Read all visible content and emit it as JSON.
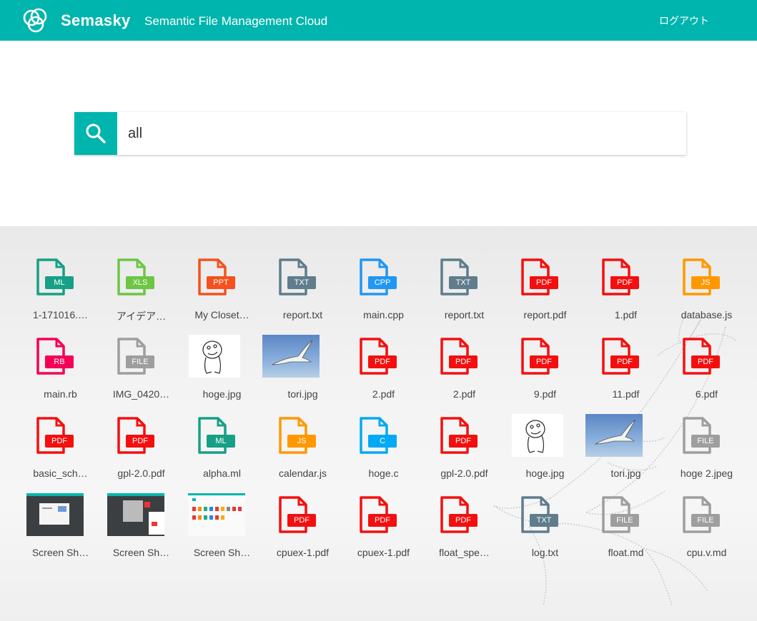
{
  "header": {
    "brand": "Semasky",
    "tagline": "Semantic File Management Cloud",
    "logout": "ログアウト",
    "brand_color": "#00b5ad"
  },
  "search": {
    "value": "all",
    "icon": "search-icon"
  },
  "type_colors": {
    "ML": "#16a085",
    "XLS": "#6cc644",
    "PPT": "#f4511e",
    "TXT": "#5f7d8c",
    "CPP": "#2196f3",
    "C": "#03a9f4",
    "PDF": "#f40f0f",
    "JS": "#ff9800",
    "RB": "#f50057",
    "FILE": "#9e9e9e"
  },
  "files": [
    {
      "name": "1-171016.…",
      "type": "ML",
      "kind": "icon"
    },
    {
      "name": "アイデア…",
      "type": "XLS",
      "kind": "icon"
    },
    {
      "name": "My Closet…",
      "type": "PPT",
      "kind": "icon"
    },
    {
      "name": "report.txt",
      "type": "TXT",
      "kind": "icon"
    },
    {
      "name": "main.cpp",
      "type": "CPP",
      "kind": "icon"
    },
    {
      "name": "report.txt",
      "type": "TXT",
      "kind": "icon"
    },
    {
      "name": "report.pdf",
      "type": "PDF",
      "kind": "icon"
    },
    {
      "name": "1.pdf",
      "type": "PDF",
      "kind": "icon"
    },
    {
      "name": "database.js",
      "type": "JS",
      "kind": "icon"
    },
    {
      "name": "main.rb",
      "type": "RB",
      "kind": "icon"
    },
    {
      "name": "IMG_0420…",
      "type": "FILE",
      "kind": "icon"
    },
    {
      "name": "hoge.jpg",
      "type": "",
      "kind": "doodle"
    },
    {
      "name": "tori.jpg",
      "type": "",
      "kind": "sky"
    },
    {
      "name": "2.pdf",
      "type": "PDF",
      "kind": "icon"
    },
    {
      "name": "2.pdf",
      "type": "PDF",
      "kind": "icon"
    },
    {
      "name": "9.pdf",
      "type": "PDF",
      "kind": "icon"
    },
    {
      "name": "11.pdf",
      "type": "PDF",
      "kind": "icon"
    },
    {
      "name": "6.pdf",
      "type": "PDF",
      "kind": "icon"
    },
    {
      "name": "basic_sch…",
      "type": "PDF",
      "kind": "icon"
    },
    {
      "name": "gpl-2.0.pdf",
      "type": "PDF",
      "kind": "icon"
    },
    {
      "name": "alpha.ml",
      "type": "ML",
      "kind": "icon"
    },
    {
      "name": "calendar.js",
      "type": "JS",
      "kind": "icon"
    },
    {
      "name": "hoge.c",
      "type": "C",
      "kind": "icon"
    },
    {
      "name": "gpl-2.0.pdf",
      "type": "PDF",
      "kind": "icon"
    },
    {
      "name": "hoge.jpg",
      "type": "",
      "kind": "doodle"
    },
    {
      "name": "tori.jpg",
      "type": "",
      "kind": "sky"
    },
    {
      "name": "hoge 2.jpeg",
      "type": "FILE",
      "kind": "icon"
    },
    {
      "name": "Screen Sh…",
      "type": "",
      "kind": "shot-dark"
    },
    {
      "name": "Screen Sh…",
      "type": "",
      "kind": "shot-dark2"
    },
    {
      "name": "Screen Sh…",
      "type": "",
      "kind": "shot-light"
    },
    {
      "name": "cpuex-1.pdf",
      "type": "PDF",
      "kind": "icon"
    },
    {
      "name": "cpuex-1.pdf",
      "type": "PDF",
      "kind": "icon"
    },
    {
      "name": "float_spe…",
      "type": "PDF",
      "kind": "icon"
    },
    {
      "name": "log.txt",
      "type": "TXT",
      "kind": "icon"
    },
    {
      "name": "float.md",
      "type": "FILE",
      "kind": "icon"
    },
    {
      "name": "cpu.v.md",
      "type": "FILE",
      "kind": "icon"
    }
  ]
}
